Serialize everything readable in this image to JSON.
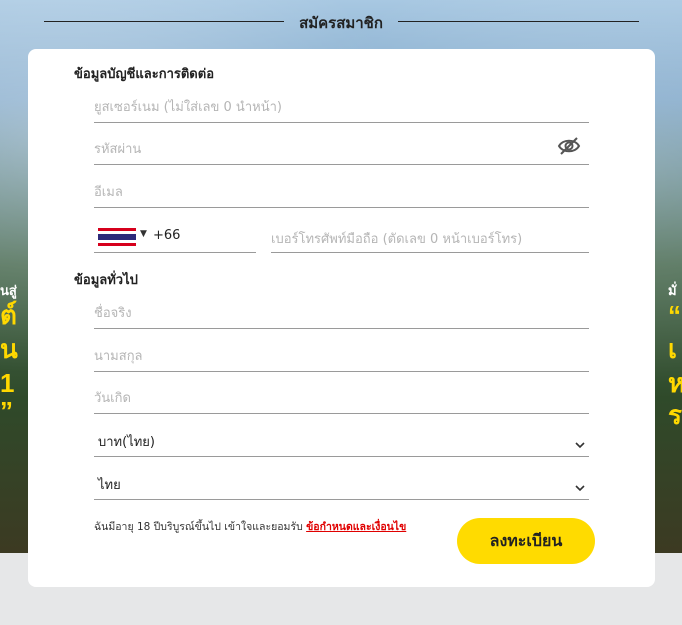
{
  "header": {
    "title": "สมัครสมาชิก"
  },
  "background": {
    "left_promo_small": "นสู่",
    "left_promo_lines": [
      "ต์",
      "น",
      "1",
      "”"
    ],
    "right_promo_small": "มั่",
    "right_promo_lines": [
      "“",
      "เ",
      "ห",
      "ร"
    ]
  },
  "account_section": {
    "title": "ข้อมูลบัญชีและการติดต่อ",
    "username_placeholder": "ยูสเซอร์เนม (ไม่ใส่เลข 0 นำหน้า)",
    "password_placeholder": "รหัสผ่าน",
    "email_placeholder": "อีเมล",
    "country_code": "+66",
    "phone_placeholder": "เบอร์โทรศัพท์มือถือ (ตัดเลข 0 หน้าเบอร์โทร)"
  },
  "general_section": {
    "title": "ข้อมูลทั่วไป",
    "firstname_placeholder": "ชื่อจริง",
    "lastname_placeholder": "นามสกุล",
    "birthdate_placeholder": "วันเกิด",
    "currency_value": "บาท(ไทย)",
    "language_value": "ไทย"
  },
  "terms": {
    "text": "ฉันมีอายุ 18 ปีบริบูรณ์ขึ้นไป เข้าใจและยอมรับ",
    "link": "ข้อกำหนดและเงื่อนไข"
  },
  "register_button": "ลงทะเบียน",
  "icons": [
    "eye-off-icon",
    "thailand-flag-icon",
    "caret-down-icon",
    "chevron-down-icon"
  ],
  "colors": {
    "accent_yellow": "#ffdb00",
    "link_red": "#e00000",
    "page_bottom": "#e6e7e8"
  }
}
